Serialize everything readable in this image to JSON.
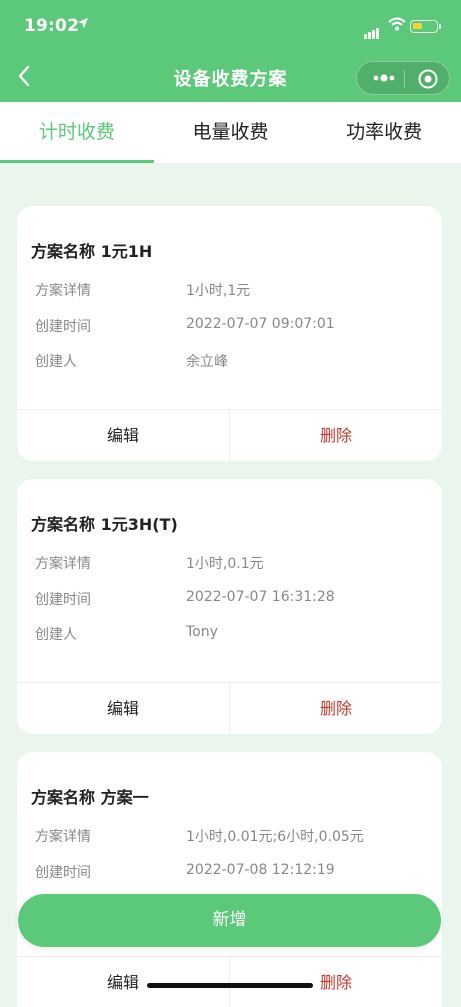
{
  "status": {
    "time": "19:02"
  },
  "nav": {
    "title": "设备收费方案"
  },
  "tabs": [
    {
      "label": "计时收费"
    },
    {
      "label": "电量收费"
    },
    {
      "label": "功率收费"
    }
  ],
  "labels": {
    "detail": "方案详情",
    "created_time": "创建时间",
    "creator": "创建人",
    "edit": "编辑",
    "delete": "删除"
  },
  "plans": [
    {
      "name": "方案名称 1元1H",
      "detail": "1小时,1元",
      "created_time": "2022-07-07 09:07:01",
      "creator": "余立峰"
    },
    {
      "name": "方案名称 1元3H(T)",
      "detail": "1小时,0.1元",
      "created_time": "2022-07-07 16:31:28",
      "creator": "Tony"
    },
    {
      "name": "方案名称 方案一",
      "detail": "1小时,0.01元;6小时,0.05元",
      "created_time": "2022-07-08 12:12:19"
    }
  ],
  "add_button": "新增",
  "colors": {
    "accent": "#5cc87a",
    "danger": "#c0392b"
  }
}
